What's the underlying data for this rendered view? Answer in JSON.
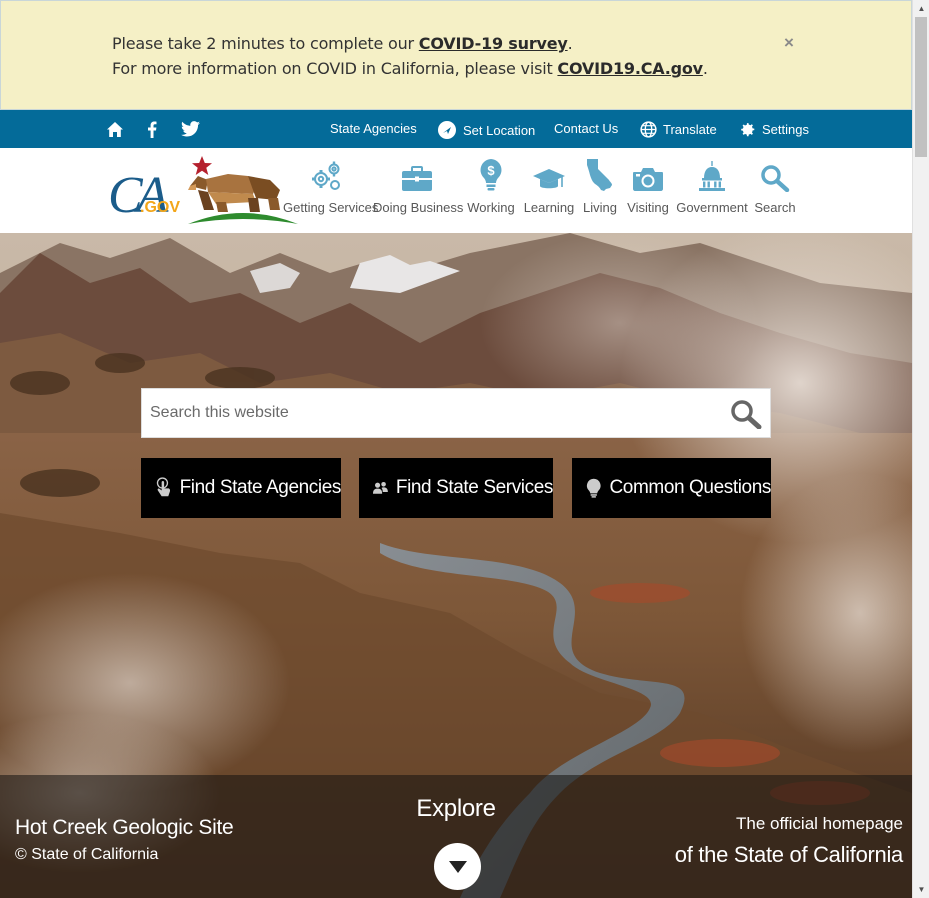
{
  "alert": {
    "line1_prefix": "Please take 2 minutes to complete our ",
    "line1_link": "COVID-19 survey",
    "line1_suffix": ".",
    "line2_prefix": "For more information on COVID in California, please visit ",
    "line2_link": "COVID19.CA.gov",
    "line2_suffix": ".",
    "close_label": "×"
  },
  "utility": {
    "icons": [
      "home-icon",
      "facebook-icon",
      "twitter-icon"
    ],
    "links": {
      "state_agencies": "State Agencies",
      "set_location": "Set Location",
      "contact_us": "Contact Us",
      "translate": "Translate",
      "settings": "Settings"
    },
    "bg_color": "#046b99"
  },
  "logo": {
    "text": "CA",
    "suffix": ".GOV"
  },
  "nav": {
    "items": [
      {
        "label": "Getting Services",
        "icon": "gears-icon"
      },
      {
        "label": "Doing Business",
        "icon": "briefcase-icon"
      },
      {
        "label": "Working",
        "icon": "lightbulb-dollar-icon"
      },
      {
        "label": "Learning",
        "icon": "graduation-cap-icon"
      },
      {
        "label": "Living",
        "icon": "california-icon"
      },
      {
        "label": "Visiting",
        "icon": "camera-icon"
      },
      {
        "label": "Government",
        "icon": "capitol-icon"
      },
      {
        "label": "Search",
        "icon": "search-icon"
      }
    ]
  },
  "hero": {
    "search_placeholder": "Search this website",
    "buttons": {
      "agencies": "Find State Agencies",
      "services": "Find State Services",
      "questions": "Common Questions"
    },
    "caption_title": "Hot Creek Geologic Site",
    "caption_sub": "© State of California",
    "explore": "Explore",
    "official_line1": "The official homepage",
    "official_line2": "of the State of California"
  }
}
